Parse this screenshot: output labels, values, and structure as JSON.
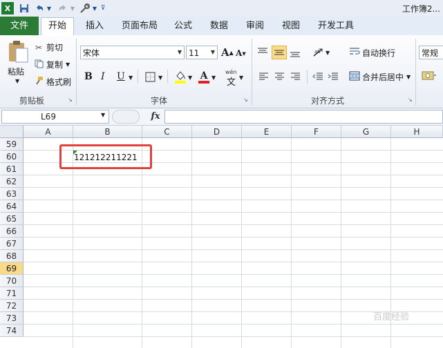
{
  "title": "工作簿2...",
  "quick_access": {
    "save": "save-icon",
    "undo": "undo-icon",
    "redo": "redo-icon",
    "tools": "tools-icon"
  },
  "tabs": [
    "文件",
    "开始",
    "插入",
    "页面布局",
    "公式",
    "数据",
    "审阅",
    "视图",
    "开发工具"
  ],
  "ribbon": {
    "clipboard": {
      "paste": "粘贴",
      "cut": "剪切",
      "copy": "复制",
      "format_painter": "格式刷",
      "label": "剪贴板"
    },
    "font": {
      "name": "宋体",
      "size": "11",
      "grow": "A",
      "shrink": "A",
      "bold": "B",
      "italic": "I",
      "underline": "U",
      "label": "字体",
      "phonetic": "wén"
    },
    "alignment": {
      "wrap": "自动换行",
      "merge": "合并后居中",
      "label": "对齐方式"
    },
    "number": {
      "format": "常规"
    }
  },
  "formula_bar": {
    "name_box": "L69",
    "fx": "fx",
    "value": ""
  },
  "columns": [
    "A",
    "B",
    "C",
    "D",
    "E",
    "F",
    "G",
    "H"
  ],
  "rows": [
    "59",
    "60",
    "61",
    "62",
    "63",
    "64",
    "65",
    "66",
    "67",
    "68",
    "69",
    "70",
    "71",
    "72",
    "73",
    "74"
  ],
  "active_row": "69",
  "cells": {
    "B60": "121212211221"
  },
  "watermark": "百度经验",
  "colors": {
    "file_tab": "#2b7a35",
    "highlight": "#e2403a",
    "active_row": "#f9d98a"
  }
}
